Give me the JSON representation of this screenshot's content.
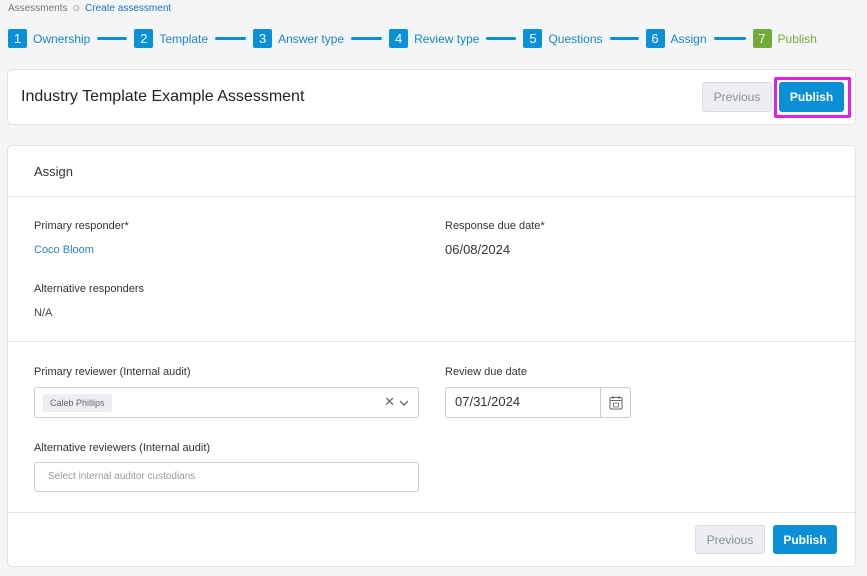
{
  "breadcrumb": {
    "root": "Assessments",
    "separator": "⊙",
    "current": "Create assessment"
  },
  "stepper": [
    {
      "num": "1",
      "label": "Ownership"
    },
    {
      "num": "2",
      "label": "Template"
    },
    {
      "num": "3",
      "label": "Answer type"
    },
    {
      "num": "4",
      "label": "Review type"
    },
    {
      "num": "5",
      "label": "Questions"
    },
    {
      "num": "6",
      "label": "Assign"
    },
    {
      "num": "7",
      "label": "Publish"
    }
  ],
  "header": {
    "title": "Industry Template Example Assessment",
    "previous_label": "Previous",
    "publish_label": "Publish"
  },
  "assign": {
    "section_title": "Assign",
    "primary_responder_label": "Primary responder*",
    "primary_responder_value": "Coco Bloom",
    "response_due_label": "Response due date*",
    "response_due_value": "06/08/2024",
    "alt_responders_label": "Alternative responders",
    "alt_responders_value": "N/A",
    "primary_reviewer_label": "Primary reviewer (Internal audit)",
    "primary_reviewer_tag": "Caleb Phillips",
    "review_due_label": "Review due date",
    "review_due_value": "07/31/2024",
    "alt_reviewers_label": "Alternative reviewers (Internal audit)",
    "alt_reviewers_placeholder": "Select internal auditor custodians",
    "clear_glyph": "✕"
  },
  "footer": {
    "previous_label": "Previous",
    "publish_label": "Publish"
  },
  "colors": {
    "accent": "#0b8fd6",
    "step_done": "#72ab3c",
    "highlight": "#e51fe0",
    "link": "#2a7fc8"
  }
}
